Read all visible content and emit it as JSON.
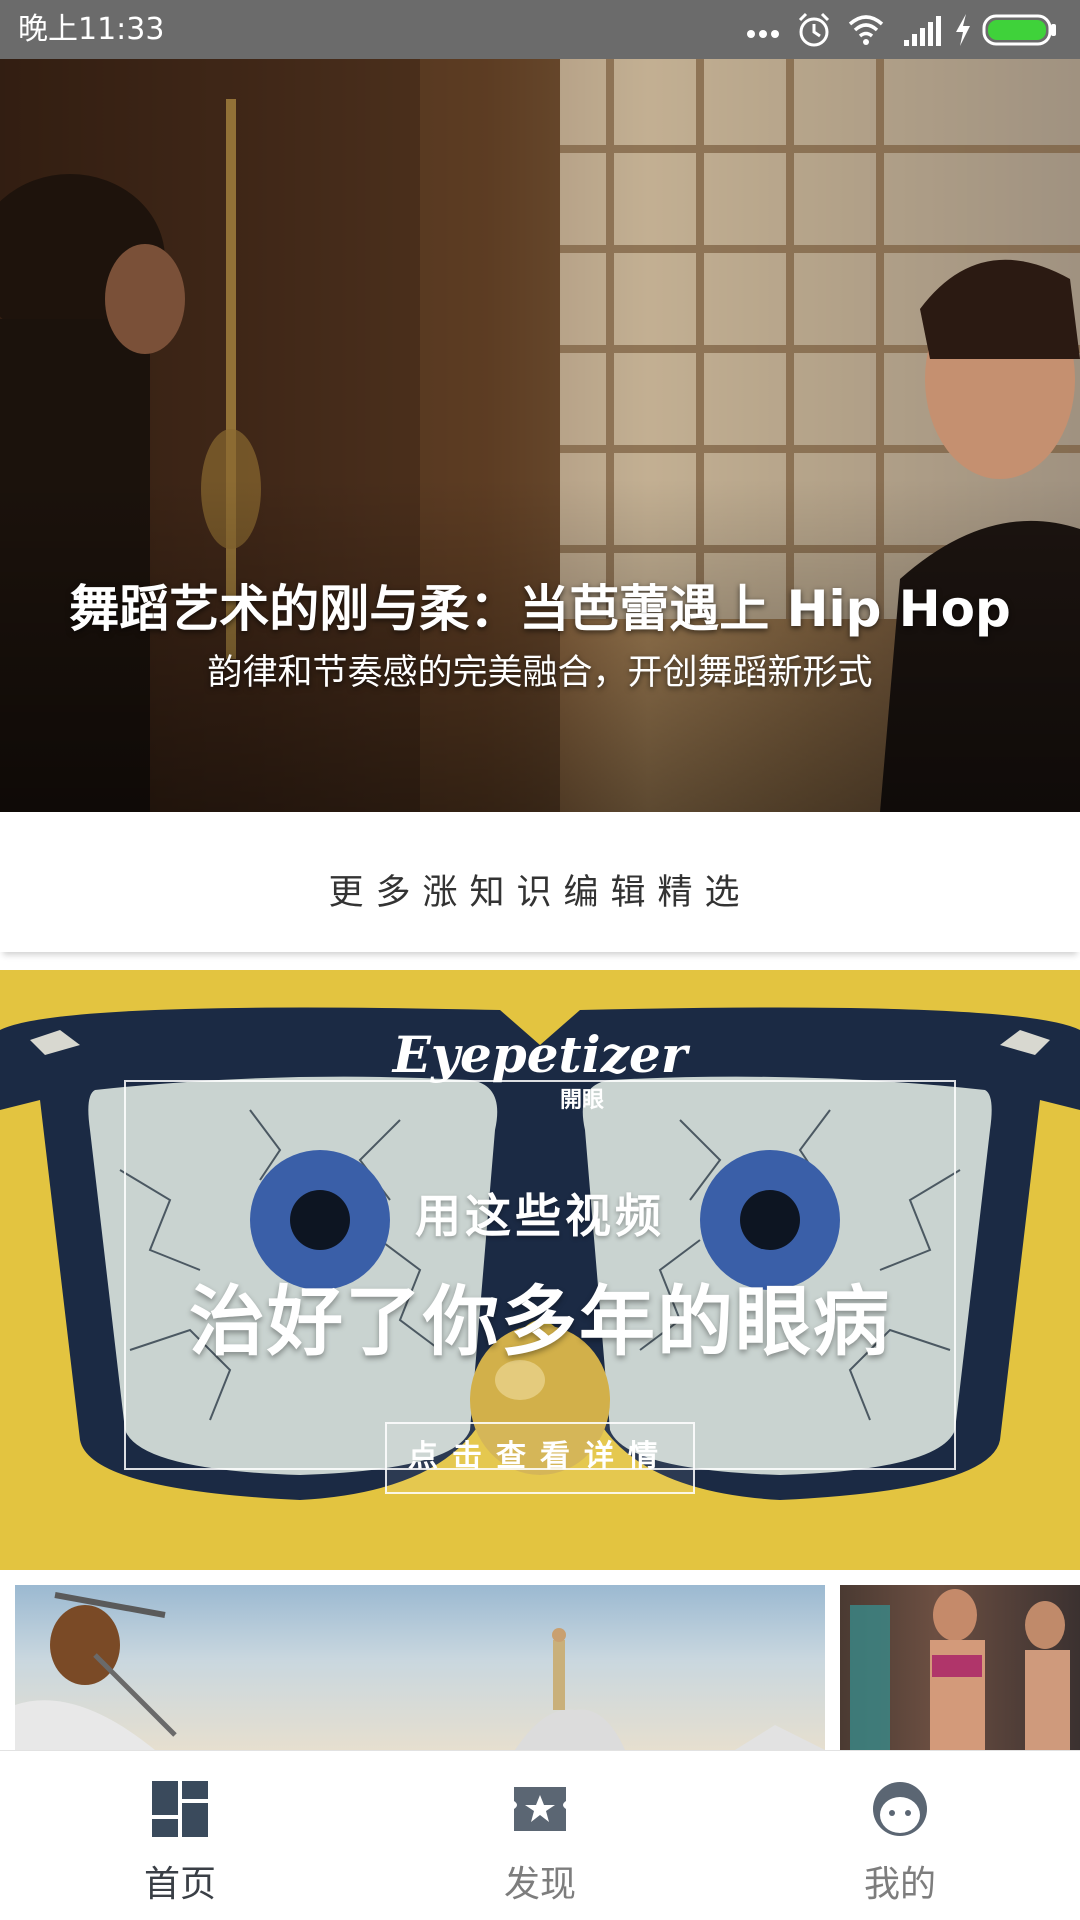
{
  "status_bar": {
    "time": "晚上11:33",
    "icons": [
      "more-dots-icon",
      "alarm-icon",
      "wifi-icon",
      "signal-icon",
      "charging-icon",
      "battery-icon"
    ]
  },
  "hero": {
    "title": "舞蹈艺术的刚与柔：当芭蕾遇上 Hip Hop",
    "subtitle": "韵律和节奏感的完美融合，开创舞蹈新形式"
  },
  "more_section": {
    "label": "更多涨知识编辑精选"
  },
  "promo": {
    "brand": "Eyepetizer",
    "brand_sub": "開眼",
    "line1": "用这些视频",
    "line2": "治好了你多年的眼病",
    "cta": "点击查看详情",
    "background_color": "#e7c644"
  },
  "bottom_nav": {
    "items": [
      {
        "label": "首页",
        "icon": "home-grid-icon",
        "active": true
      },
      {
        "label": "发现",
        "icon": "star-ticket-icon",
        "active": false
      },
      {
        "label": "我的",
        "icon": "face-icon",
        "active": false
      }
    ]
  },
  "colors": {
    "status_bar": "#6b6b6b",
    "nav_active": "#3a3f46",
    "nav_inactive": "#7d7d7d",
    "battery": "#3fd23a"
  }
}
